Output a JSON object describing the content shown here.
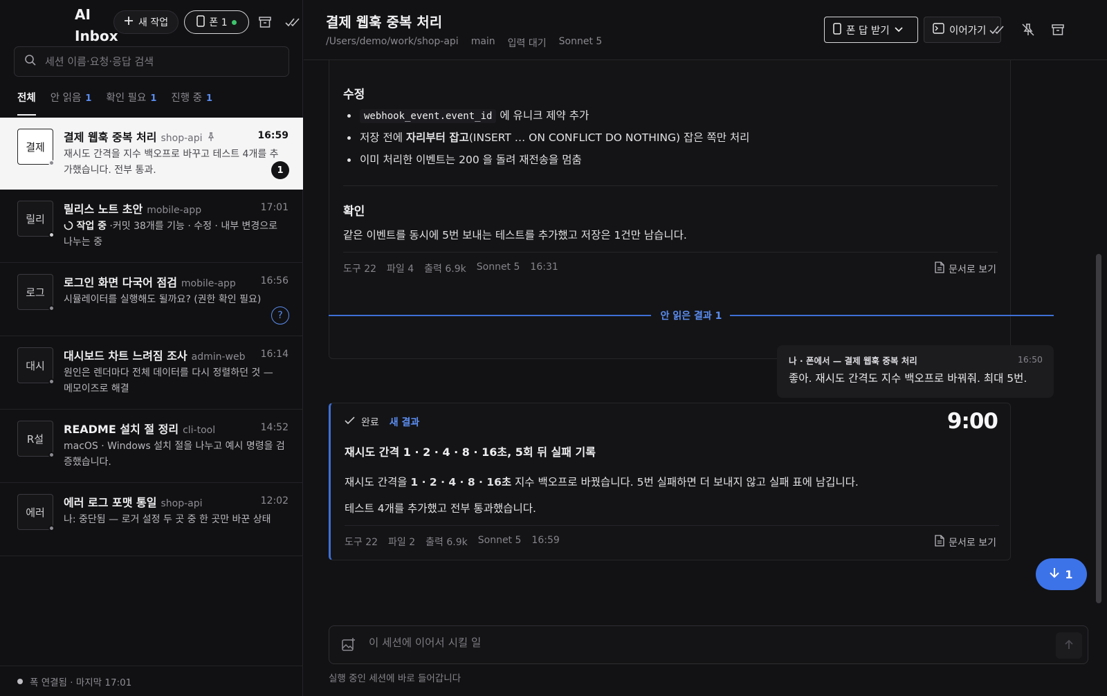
{
  "sidebar": {
    "brand": "AI\nInbox",
    "new_task_label": "새 작업",
    "phone_label": "폰 1",
    "search_placeholder": "세션 이름·요청·응답 검색",
    "tabs": [
      {
        "label": "전체",
        "count": ""
      },
      {
        "label": "안 읽음",
        "count": "1"
      },
      {
        "label": "확인 필요",
        "count": "1"
      },
      {
        "label": "진행 중",
        "count": "1"
      }
    ],
    "items": [
      {
        "avatar": "결제",
        "title": "결제 웹훅 중복 처리",
        "project": "shop-api",
        "time": "16:59",
        "body": "재시도 간격을 지수 백오프로 바꾸고 테스트 4개를 추가했습니다. 전부 통과.",
        "badge": "1"
      },
      {
        "avatar": "릴리",
        "title": "릴리스 노트 초안",
        "project": "mobile-app",
        "time": "17:01",
        "status": "작업 중",
        "body": "·커밋 38개를 기능 · 수정 · 내부 변경으로 나누는 중"
      },
      {
        "avatar": "로그",
        "title": "로그인 화면 다국어 점검",
        "project": "mobile-app",
        "time": "16:56",
        "body": "시뮬레이터를 실행해도 될까요? (권한 확인 필요)",
        "badge": "?"
      },
      {
        "avatar": "대시",
        "title": "대시보드 차트 느려짐 조사",
        "project": "admin-web",
        "time": "16:14",
        "body": "원인은 렌더마다 전체 데이터를 다시 정렬하던 것 — 메모이즈로 해결"
      },
      {
        "avatar": "R설",
        "title": "README 설치 절 정리",
        "project": "cli-tool",
        "time": "14:52",
        "body": "macOS · Windows 설치 절을 나누고 예시 명령을 검증했습니다."
      },
      {
        "avatar": "에러",
        "title": "에러 로그 포맷 통일",
        "project": "shop-api",
        "time": "12:02",
        "body": "나: 중단됨 — 로거 설정 두 곳 중 한 곳만 바꾼 상태"
      }
    ],
    "footer": "폭 연결됨 · 마지막 17:01"
  },
  "main": {
    "title": "결제 웹훅 중복 처리",
    "meta": [
      "/Users/demo/work/shop-api",
      "main",
      "입력 대기",
      "Sonnet 5"
    ],
    "phone_reply_label": "폰 답 받기",
    "continue_label": "이어가기",
    "card1": {
      "fix_heading": "수정",
      "bullets": {
        "b1_code": "webhook_event.event_id",
        "b1_text": "에 유니크 제약 추가",
        "b2_pre": "저장 전에 ",
        "b2_bold": "자리부터 잡고",
        "b2_post": "(INSERT … ON CONFLICT DO NOTHING) 잡은 쪽만 처리",
        "b3": "이미 처리한 이벤트는 200 을 돌려 재전송을 멈춤"
      },
      "check_heading": "확인",
      "check_text": "같은 이벤트를 동시에 5번 보내는 테스트를 추가했고 저장은 1건만 남습니다.",
      "footer": [
        "도구 22",
        "파일 4",
        "출력 6.9k",
        "Sonnet 5",
        "16:31"
      ],
      "doc_link": "문서로 보기"
    },
    "unread_divider": "안 읽은 결과 1",
    "my_message": {
      "who": "나 · 폰에서 — 결제 웹훅 중복 처리",
      "time": "16:50",
      "text": "좋아. 재시도 간격도 지수 백오프로 바꿔줘. 최대 5번."
    },
    "card2": {
      "status": "완료",
      "new_label": "새 결과",
      "clock": "9:00",
      "title": "재시도 간격 1 · 2 · 4 · 8 · 16초, 5회 뒤 실패 기록",
      "p1_pre": "재시도 간격을 ",
      "p1_bold": "1 · 2 · 4 · 8 · 16초",
      "p1_post": " 지수 백오프로 바꿨습니다. 5번 실패하면 더 보내지 않고 실패 표에 남깁니다.",
      "p2": "테스트 4개를 추가했고 전부 통과했습니다.",
      "footer": [
        "도구 22",
        "파일 2",
        "출력 6.9k",
        "Sonnet 5",
        "16:59"
      ],
      "doc_link": "문서로 보기"
    },
    "scroll_fab_count": "1",
    "composer_placeholder": "이 세션에 이어서 시킬 일",
    "composer_hint": "실행 중인 세션에 바로 들어갑니다"
  },
  "colors": {
    "accent": "#3d73e8",
    "accent_text": "#5b8df0",
    "online": "#3ec46d"
  }
}
